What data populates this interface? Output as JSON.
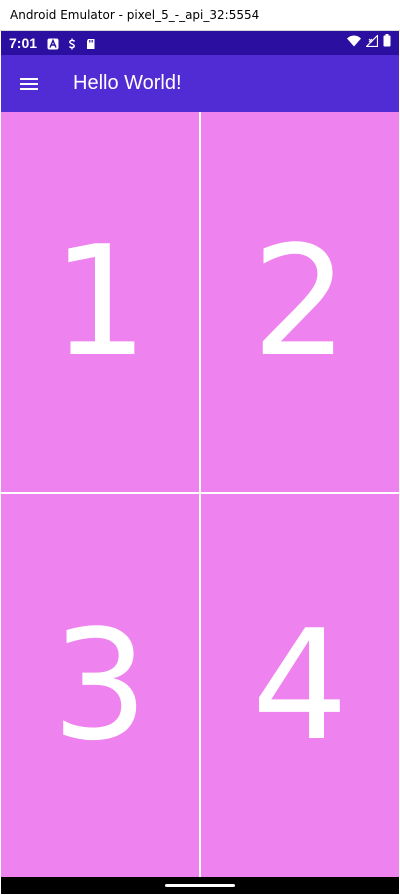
{
  "window": {
    "title": "Android Emulator - pixel_5_-_api_32:5554"
  },
  "status_bar": {
    "time": "7:01",
    "left_icons": [
      "accessibility-a-icon",
      "sync-s-icon",
      "sd-card-icon"
    ],
    "right_icons": [
      "wifi-icon",
      "cellular-signal-icon",
      "battery-icon"
    ]
  },
  "app_bar": {
    "title": "Hello World!",
    "menu_icon": "hamburger-menu-icon",
    "color": "#512bd4"
  },
  "grid": {
    "cell_color": "#ee82ee",
    "cells": [
      {
        "label": "1"
      },
      {
        "label": "2"
      },
      {
        "label": "3"
      },
      {
        "label": "4"
      }
    ]
  },
  "colors": {
    "status_bar": "#2a0fa0",
    "text_on_primary": "#ffffff"
  }
}
